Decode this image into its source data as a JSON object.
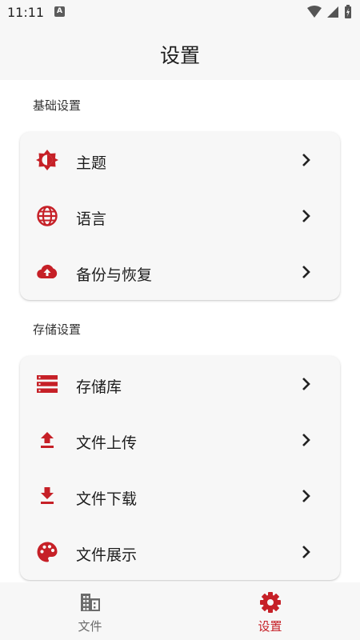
{
  "status_bar": {
    "time": "11:11",
    "notification_letter": "A"
  },
  "header": {
    "title": "设置"
  },
  "sections": [
    {
      "title": "基础设置",
      "items": [
        {
          "label": "主题",
          "icon": "brightness-icon"
        },
        {
          "label": "语言",
          "icon": "globe-icon"
        },
        {
          "label": "备份与恢复",
          "icon": "cloud-upload-icon"
        }
      ]
    },
    {
      "title": "存储设置",
      "items": [
        {
          "label": "存储库",
          "icon": "storage-icon"
        },
        {
          "label": "文件上传",
          "icon": "upload-icon"
        },
        {
          "label": "文件下载",
          "icon": "download-icon"
        },
        {
          "label": "文件展示",
          "icon": "palette-icon"
        }
      ]
    }
  ],
  "bottom_nav": {
    "items": [
      {
        "label": "文件",
        "icon": "building-icon",
        "active": false
      },
      {
        "label": "设置",
        "icon": "gear-icon",
        "active": true
      }
    ]
  },
  "colors": {
    "accent": "#c62027",
    "card_bg": "#f7f7f7",
    "inactive": "#6b6b6b"
  }
}
